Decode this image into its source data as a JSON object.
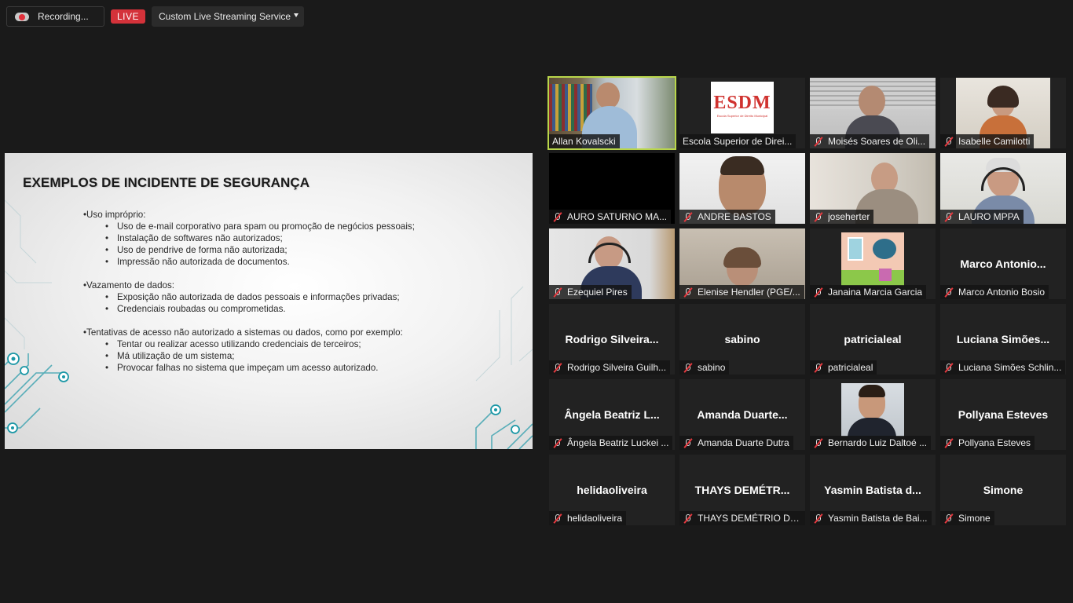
{
  "topbar": {
    "recording_label": "Recording...",
    "live_label": "LIVE",
    "service_label": "Custom Live Streaming Service"
  },
  "slide": {
    "title": "EXEMPLOS DE INCIDENTE DE SEGURANÇA",
    "sections": [
      {
        "heading": "•Uso impróprio:",
        "items": [
          "Uso de e-mail corporativo para spam ou promoção de negócios pessoais;",
          "Instalação de softwares não autorizados;",
          "Uso de pendrive de forma não autorizada;",
          "Impressão não autorizada de documentos."
        ]
      },
      {
        "heading": "•Vazamento de dados:",
        "items": [
          "Exposição não autorizada de dados pessoais e informações privadas;",
          "Credenciais roubadas ou comprometidas."
        ]
      },
      {
        "heading": "•Tentativas de acesso não autorizado a sistemas ou dados, como por exemplo:",
        "items": [
          "Tentar ou realizar acesso utilizando credenciais de terceiros;",
          "Má utilização de um sistema;",
          "Provocar falhas no sistema que impeçam um acesso autorizado."
        ]
      }
    ]
  },
  "bullet_char": "•",
  "logo_text": "ESDM",
  "logo_subtext": "Escola Superior de Direito Municipal",
  "participants": [
    {
      "name": "Allan Kovalscki",
      "muted": false,
      "video": true,
      "active": true
    },
    {
      "name": "Escola Superior de Direi...",
      "muted": false,
      "video": true
    },
    {
      "name": "Moisés Soares de Oli...",
      "muted": true,
      "video": true
    },
    {
      "name": "Isabelle Camilotti",
      "muted": true,
      "video": true
    },
    {
      "name": "AURO SATURNO MA...",
      "muted": true,
      "video": true
    },
    {
      "name": "ANDRE BASTOS",
      "muted": true,
      "video": true
    },
    {
      "name": "joseherter",
      "muted": true,
      "video": true
    },
    {
      "name": "LAURO  MPPA",
      "muted": true,
      "video": true
    },
    {
      "name": "Ezequiel Pires",
      "muted": true,
      "video": true
    },
    {
      "name": "Elenise Hendler (PGE/...",
      "muted": true,
      "video": true
    },
    {
      "name": "Janaina Marcia Garcia",
      "muted": true,
      "video": true
    },
    {
      "name": "Marco Antonio Bosio",
      "muted": true,
      "video": false,
      "display": "Marco  Antonio..."
    },
    {
      "name": "Rodrigo Silveira Guilh...",
      "muted": true,
      "video": false,
      "display": "Rodrigo  Silveira..."
    },
    {
      "name": "sabino",
      "muted": true,
      "video": false,
      "display": "sabino"
    },
    {
      "name": "patricialeal",
      "muted": true,
      "video": false,
      "display": "patricialeal"
    },
    {
      "name": "Luciana Simões Schlin...",
      "muted": true,
      "video": false,
      "display": "Luciana  Simões..."
    },
    {
      "name": "Ângela Beatriz Luckei ...",
      "muted": true,
      "video": false,
      "display": "Ângela  Beatriz  L..."
    },
    {
      "name": "Amanda Duarte Dutra",
      "muted": true,
      "video": false,
      "display": "Amanda  Duarte..."
    },
    {
      "name": "Bernardo Luiz Daltoé ...",
      "muted": true,
      "video": true
    },
    {
      "name": "Pollyana Esteves",
      "muted": true,
      "video": false,
      "display": "Pollyana  Esteves"
    },
    {
      "name": "helidaoliveira",
      "muted": true,
      "video": false,
      "display": "helidaoliveira"
    },
    {
      "name": "THAYS DEMÉTRIO DA...",
      "muted": true,
      "video": false,
      "display": "THAYS  DEMÉTR..."
    },
    {
      "name": "Yasmin Batista de Bai...",
      "muted": true,
      "video": false,
      "display": "Yasmin  Batista  d..."
    },
    {
      "name": "Simone",
      "muted": true,
      "video": false,
      "display": "Simone"
    }
  ]
}
